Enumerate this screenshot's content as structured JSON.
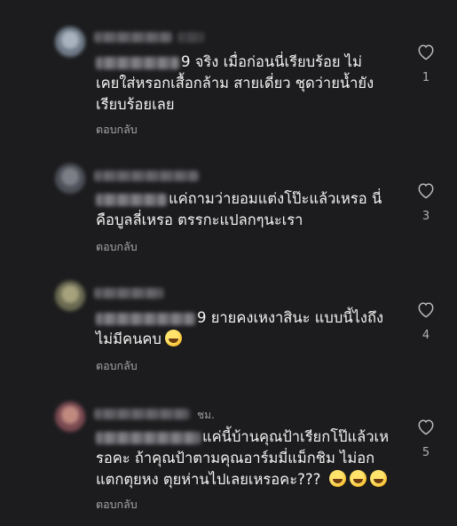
{
  "comments": [
    {
      "name_suffix": "",
      "lines": [
        "9 จริง เมื่อก่อนนี่เรียบร้อย ไม่",
        "เคยใส่หรอกเสื้อกล้าม สายเดี่ยว ชุดว่ายน้ำยัง",
        "เรียบร้อยเลย"
      ],
      "reply": "ตอบกลับ",
      "likes": "1",
      "emoji_count": 0
    },
    {
      "name_suffix": "",
      "lines": [
        "แค่ถามว่ายอมแต่งโป๊ะแล้วเหรอ นี่",
        "คือบูลลี่เหรอ ตรรกะแปลกๆนะเรา"
      ],
      "reply": "ตอบกลับ",
      "likes": "3",
      "emoji_count": 0
    },
    {
      "name_suffix": "",
      "lines": [
        "9 ยายคงเหงาสินะ แบบนี้ไงถึง",
        "ไม่มีคนคบ"
      ],
      "reply": "ตอบกลับ",
      "likes": "4",
      "emoji_count": 1
    },
    {
      "name_suffix": "ชม.",
      "lines": [
        "แค่นี้บ้านคุณป้าเรียกโป๊แล้วเห",
        "รอคะ ถ้าคุณป้าตามคุณอาร์มมี่แม็กชิม ไม่อก",
        "แตกตุยหง ตุยห่านไปเลยเหรอคะ???"
      ],
      "reply": "ตอบกลับ",
      "likes": "5",
      "emoji_count": 3
    }
  ],
  "icons": {
    "like": "heart-outline-icon",
    "emoji": "grinning-sweat-emoji",
    "laugh": "rofl-emoji"
  },
  "colors": {
    "background": "#1c1c1e",
    "text": "#f4f4f4",
    "muted": "#a6a6a6"
  }
}
